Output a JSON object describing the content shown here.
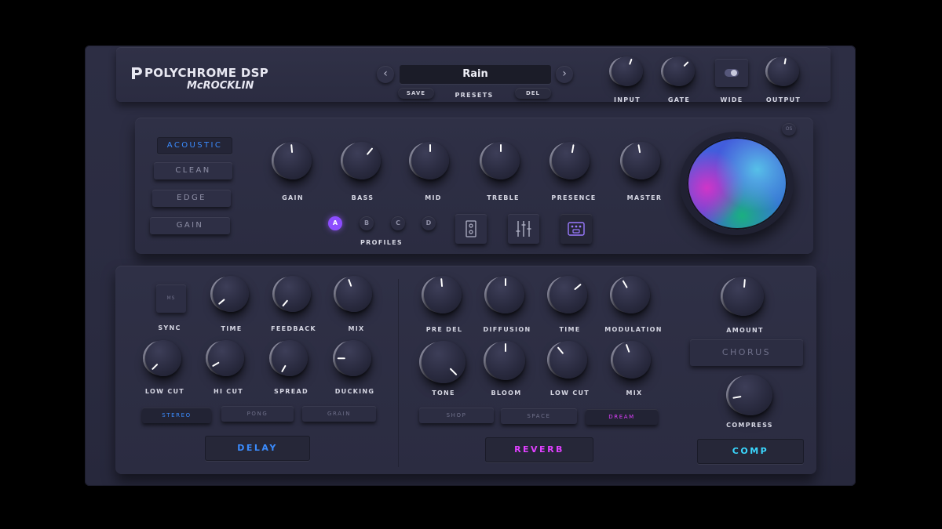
{
  "brand": {
    "name": "POLYCHROME DSP",
    "sub": "McROCKLIN"
  },
  "header": {
    "preset_name": "Rain",
    "prev_icon": "chevron-left-icon",
    "next_icon": "chevron-right-icon",
    "save_label": "SAVE",
    "presets_label": "PRESETS",
    "del_label": "DEL",
    "input_label": "INPUT",
    "gate_label": "GATE",
    "wide_label": "WIDE",
    "output_label": "OUTPUT"
  },
  "amp": {
    "modes": [
      "ACOUSTIC",
      "CLEAN",
      "EDGE",
      "GAIN"
    ],
    "active_mode": "ACOUSTIC",
    "knobs": [
      "GAIN",
      "BASS",
      "MID",
      "TREBLE",
      "PRESENCE",
      "MASTER"
    ],
    "profiles_label": "PROFILES",
    "profiles": [
      "A",
      "B",
      "C",
      "D"
    ],
    "active_profile": "A",
    "os_label": "OS",
    "icons": [
      "cabinet-icon",
      "mixer-sliders-icon",
      "pedal-icon"
    ]
  },
  "delay": {
    "sync_toggle": "MS",
    "sync_label": "SYNC",
    "top_knobs": [
      "TIME",
      "FEEDBACK",
      "MIX"
    ],
    "bottom_knobs": [
      "LOW CUT",
      "HI CUT",
      "SPREAD",
      "DUCKING"
    ],
    "modes": [
      "STEREO",
      "PONG",
      "GRAIN"
    ],
    "active_mode": "STEREO",
    "section_label": "DELAY"
  },
  "reverb": {
    "top_knobs": [
      "PRE DEL",
      "DIFFUSION",
      "TIME",
      "MODULATION"
    ],
    "bottom_knobs": [
      "TONE",
      "BLOOM",
      "LOW CUT",
      "MIX"
    ],
    "modes": [
      "SHOP",
      "SPACE",
      "DREAM"
    ],
    "active_mode": "DREAM",
    "section_label": "REVERB"
  },
  "mod": {
    "amount_label": "AMOUNT",
    "chorus_label": "CHORUS",
    "compress_label": "COMPRESS",
    "section_label": "COMP"
  },
  "colors": {
    "accent_blue": "#3b8cff",
    "accent_magenta": "#e040ff",
    "accent_cyan": "#3ad8ff",
    "profile_purple": "#8c4dff"
  }
}
